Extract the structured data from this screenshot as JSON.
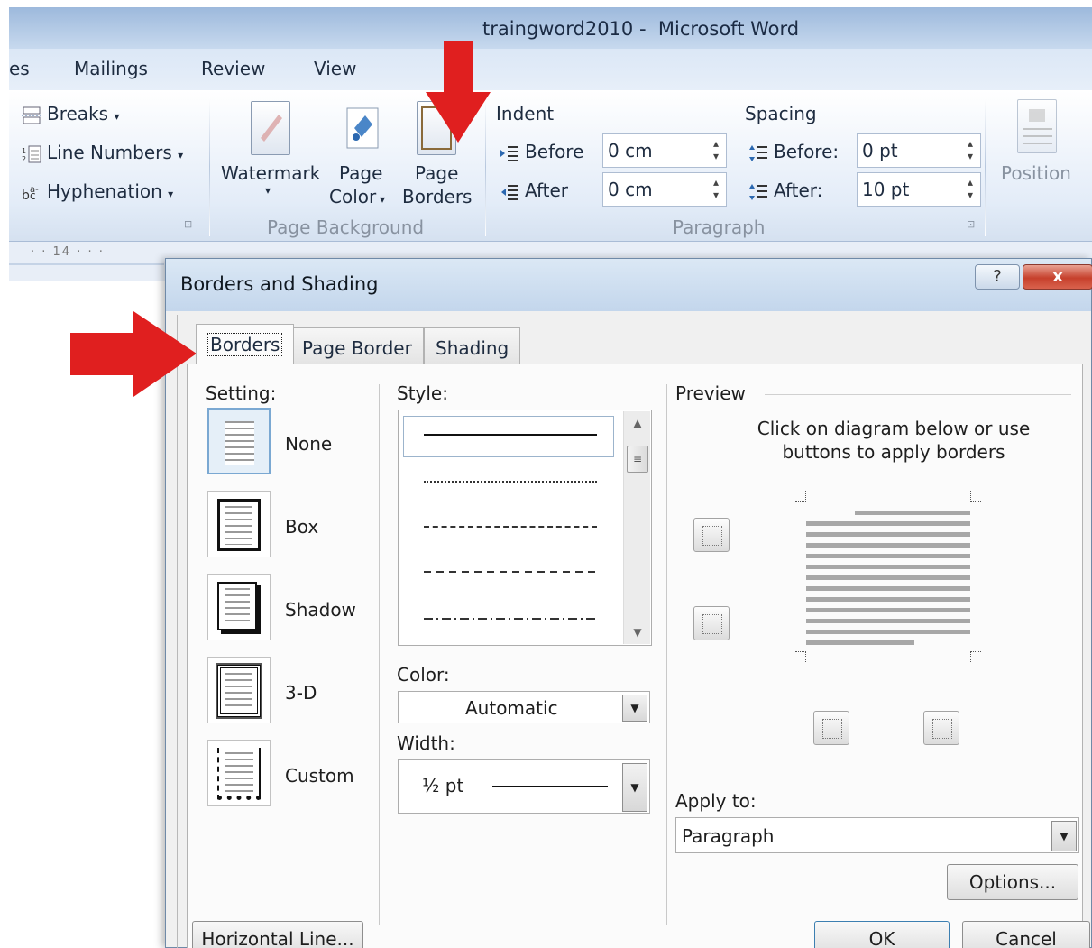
{
  "window": {
    "title": "traingword2010 -  Microsoft Word"
  },
  "menu_tabs": [
    "es",
    "Mailings",
    "Review",
    "View"
  ],
  "ribbon": {
    "page_setup": {
      "breaks": "Breaks",
      "line_numbers": "Line Numbers",
      "hyphenation": "Hyphenation"
    },
    "page_background": {
      "watermark": "Watermark",
      "page_color": [
        "Page",
        "Color"
      ],
      "page_borders": [
        "Page",
        "Borders"
      ],
      "group_label": "Page Background"
    },
    "paragraph": {
      "indent_header": "Indent",
      "spacing_header": "Spacing",
      "indent_before_label": "Before",
      "indent_before_value": "0 cm",
      "indent_after_label": "After",
      "indent_after_value": "0 cm",
      "spacing_before_label": "Before:",
      "spacing_before_value": "0 pt",
      "spacing_after_label": "After:",
      "spacing_after_value": "10 pt",
      "group_label": "Paragraph"
    },
    "arrange": {
      "position": "Position"
    }
  },
  "ruler": {
    "marker": "14"
  },
  "dialog": {
    "title": "Borders and Shading",
    "help": "?",
    "close": "x",
    "tabs": [
      "Borders",
      "Page Border",
      "Shading"
    ],
    "active_tab": "Borders",
    "setting_label": "Setting:",
    "settings": [
      "None",
      "Box",
      "Shadow",
      "3-D",
      "Custom"
    ],
    "selected_setting": "None",
    "style_label": "Style:",
    "color_label": "Color:",
    "color_value": "Automatic",
    "width_label": "Width:",
    "width_value": "½ pt",
    "preview_label": "Preview",
    "preview_hint": [
      "Click on diagram below or use",
      "buttons to apply borders"
    ],
    "apply_to_label": "Apply to:",
    "apply_to_value": "Paragraph",
    "options_button": "Options...",
    "bottom_buttons": [
      "Horizontal Line...",
      "OK",
      "Cancel"
    ]
  },
  "colors": {
    "annotation_arrow": "#e01f1f",
    "title_bar": "#b9cfe9",
    "dialog_bg": "#f0f0f0"
  }
}
